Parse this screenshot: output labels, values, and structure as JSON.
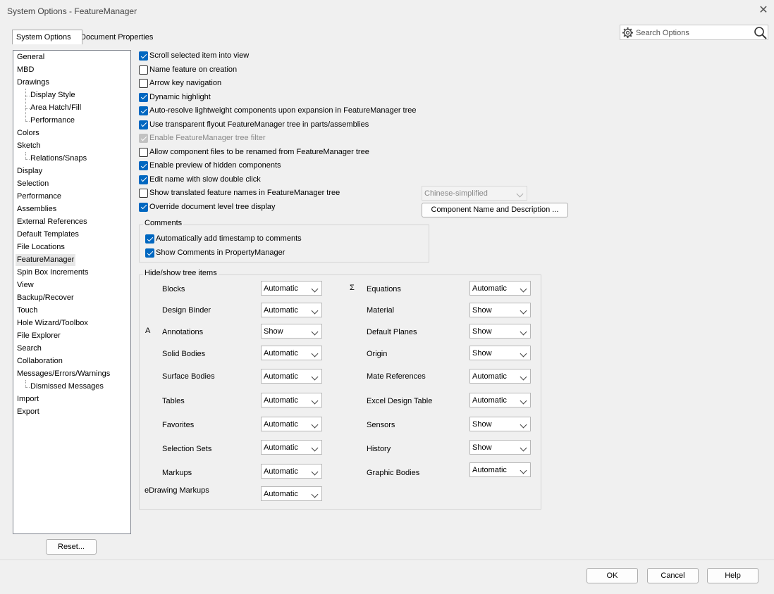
{
  "window": {
    "title": "System Options - FeatureManager",
    "close_glyph": "✕"
  },
  "tabs": {
    "system": "System Options",
    "document": "Document Properties"
  },
  "search": {
    "placeholder": "Search Options"
  },
  "nav": {
    "items": [
      {
        "label": "General",
        "indent": 0
      },
      {
        "label": "MBD",
        "indent": 0
      },
      {
        "label": "Drawings",
        "indent": 0
      },
      {
        "label": "Display Style",
        "indent": 1
      },
      {
        "label": "Area Hatch/Fill",
        "indent": 1
      },
      {
        "label": "Performance",
        "indent": 1
      },
      {
        "label": "Colors",
        "indent": 0
      },
      {
        "label": "Sketch",
        "indent": 0
      },
      {
        "label": "Relations/Snaps",
        "indent": 1
      },
      {
        "label": "Display",
        "indent": 0
      },
      {
        "label": "Selection",
        "indent": 0
      },
      {
        "label": "Performance",
        "indent": 0
      },
      {
        "label": "Assemblies",
        "indent": 0
      },
      {
        "label": "External References",
        "indent": 0
      },
      {
        "label": "Default Templates",
        "indent": 0
      },
      {
        "label": "File Locations",
        "indent": 0
      },
      {
        "label": "FeatureManager",
        "indent": 0,
        "selected": true
      },
      {
        "label": "Spin Box Increments",
        "indent": 0
      },
      {
        "label": "View",
        "indent": 0
      },
      {
        "label": "Backup/Recover",
        "indent": 0
      },
      {
        "label": "Touch",
        "indent": 0
      },
      {
        "label": "Hole Wizard/Toolbox",
        "indent": 0
      },
      {
        "label": "File Explorer",
        "indent": 0
      },
      {
        "label": "Search",
        "indent": 0
      },
      {
        "label": "Collaboration",
        "indent": 0
      },
      {
        "label": "Messages/Errors/Warnings",
        "indent": 0
      },
      {
        "label": "Dismissed Messages",
        "indent": 1
      },
      {
        "label": "Import",
        "indent": 0
      },
      {
        "label": "Export",
        "indent": 0
      }
    ]
  },
  "options": [
    {
      "label": "Scroll selected item into view",
      "checked": true,
      "disabled": false
    },
    {
      "label": "Name feature on creation",
      "checked": false,
      "disabled": false
    },
    {
      "label": "Arrow key navigation",
      "checked": false,
      "disabled": false
    },
    {
      "label": "Dynamic highlight",
      "checked": true,
      "disabled": false
    },
    {
      "label": "Auto-resolve lightweight components upon expansion in FeatureManager tree",
      "checked": true,
      "disabled": false
    },
    {
      "label": "Use transparent flyout FeatureManager tree in parts/assemblies",
      "checked": true,
      "disabled": false
    },
    {
      "label": "Enable FeatureManager tree filter",
      "checked": true,
      "disabled": true
    },
    {
      "label": "Allow component files to be renamed from FeatureManager tree",
      "checked": false,
      "disabled": false
    },
    {
      "label": "Enable preview of hidden components",
      "checked": true,
      "disabled": false
    },
    {
      "label": "Edit name with slow double click",
      "checked": true,
      "disabled": false
    },
    {
      "label": "Show translated feature names in FeatureManager tree",
      "checked": false,
      "disabled": false
    },
    {
      "label": "Override document level tree display",
      "checked": true,
      "disabled": false
    }
  ],
  "language_select": {
    "value": "Chinese-simplified"
  },
  "component_name_button": "Component Name and Description ...",
  "comments": {
    "title": "Comments",
    "options": [
      {
        "label": "Automatically add timestamp to comments",
        "checked": true
      },
      {
        "label": "Show Comments in PropertyManager",
        "checked": true
      }
    ]
  },
  "tree_items": {
    "title": "Hide/show tree items",
    "left": [
      {
        "label": "Blocks",
        "value": "Automatic",
        "icon": "blocks-icon"
      },
      {
        "label": "Design Binder",
        "value": "Automatic",
        "icon": "design-binder-icon"
      },
      {
        "label": "Annotations",
        "value": "Show",
        "icon": "annotations-icon"
      },
      {
        "label": "Solid Bodies",
        "value": "Automatic",
        "icon": "solid-bodies-icon"
      },
      {
        "label": "Surface Bodies",
        "value": "Automatic",
        "icon": "surface-bodies-icon"
      },
      {
        "label": "Tables",
        "value": "Automatic",
        "icon": "tables-icon"
      },
      {
        "label": "Favorites",
        "value": "Automatic",
        "icon": "favorites-icon"
      },
      {
        "label": "Selection Sets",
        "value": "Automatic",
        "icon": "selection-sets-icon"
      },
      {
        "label": "Markups",
        "value": "Automatic",
        "icon": "markups-icon"
      },
      {
        "label": "eDrawing Markups",
        "value": "Automatic",
        "icon": ""
      }
    ],
    "right": [
      {
        "label": "Equations",
        "value": "Automatic",
        "icon": "equations-icon"
      },
      {
        "label": "Material",
        "value": "Show",
        "icon": "material-icon"
      },
      {
        "label": "Default Planes",
        "value": "Show",
        "icon": "default-planes-icon"
      },
      {
        "label": "Origin",
        "value": "Show",
        "icon": "origin-icon"
      },
      {
        "label": "Mate References",
        "value": "Automatic",
        "icon": "mate-references-icon"
      },
      {
        "label": "Excel Design Table",
        "value": "Automatic",
        "icon": "excel-design-table-icon"
      },
      {
        "label": "Sensors",
        "value": "Show",
        "icon": "sensors-icon"
      },
      {
        "label": "History",
        "value": "Show",
        "icon": "history-icon"
      },
      {
        "label": "Graphic Bodies",
        "value": "Automatic",
        "icon": "graphic-bodies-icon"
      }
    ]
  },
  "buttons": {
    "reset": "Reset...",
    "ok": "OK",
    "cancel": "Cancel",
    "help": "Help"
  },
  "colors": {
    "accent": "#0067c0",
    "selected_item": "#e8e8e8"
  }
}
